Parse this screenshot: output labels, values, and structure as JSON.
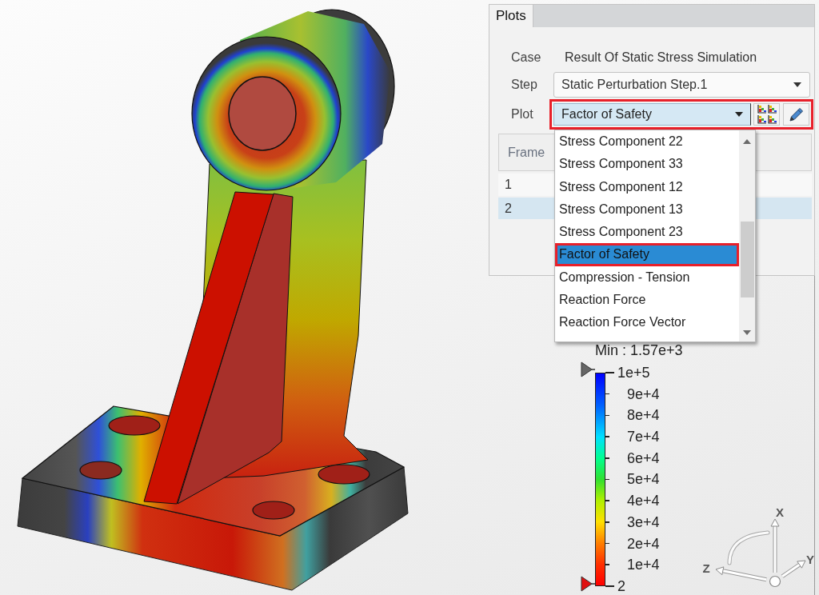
{
  "panel": {
    "tabs": [
      {
        "label": "Plots",
        "selected": true
      }
    ],
    "case": {
      "label": "Case",
      "value": "Result Of Static Stress Simulation"
    },
    "step": {
      "label": "Step",
      "value": "Static Perturbation Step.1"
    },
    "plot": {
      "label": "Plot",
      "value": "Factor of Safety",
      "highlighted": true,
      "expanded": true,
      "options": [
        {
          "label": "Stress Component 22",
          "selected": false,
          "highlighted": false
        },
        {
          "label": "Stress Component 33",
          "selected": false,
          "highlighted": false
        },
        {
          "label": "Stress Component 12",
          "selected": false,
          "highlighted": false
        },
        {
          "label": "Stress Component 13",
          "selected": false,
          "highlighted": false
        },
        {
          "label": "Stress Component 23",
          "selected": false,
          "highlighted": false
        },
        {
          "label": "Factor of Safety",
          "selected": true,
          "highlighted": true
        },
        {
          "label": "Compression - Tension",
          "selected": false,
          "highlighted": false
        },
        {
          "label": "Reaction Force",
          "selected": false,
          "highlighted": false
        },
        {
          "label": "Reaction Force Vector",
          "selected": false,
          "highlighted": false
        }
      ]
    },
    "table": {
      "columns": [
        "Frame"
      ],
      "rows": [
        {
          "cells": [
            "1"
          ],
          "selected": false
        },
        {
          "cells": [
            "2"
          ],
          "selected": true
        }
      ]
    }
  },
  "legend": {
    "min_label": "Min : 1.57e+3",
    "ticks": [
      "1e+5",
      "9e+4",
      "8e+4",
      "7e+4",
      "6e+4",
      "5e+4",
      "4e+4",
      "3e+4",
      "2e+4",
      "1e+4",
      "2"
    ]
  },
  "axis_triad": {
    "labels": [
      "X",
      "Y",
      "Z"
    ]
  }
}
